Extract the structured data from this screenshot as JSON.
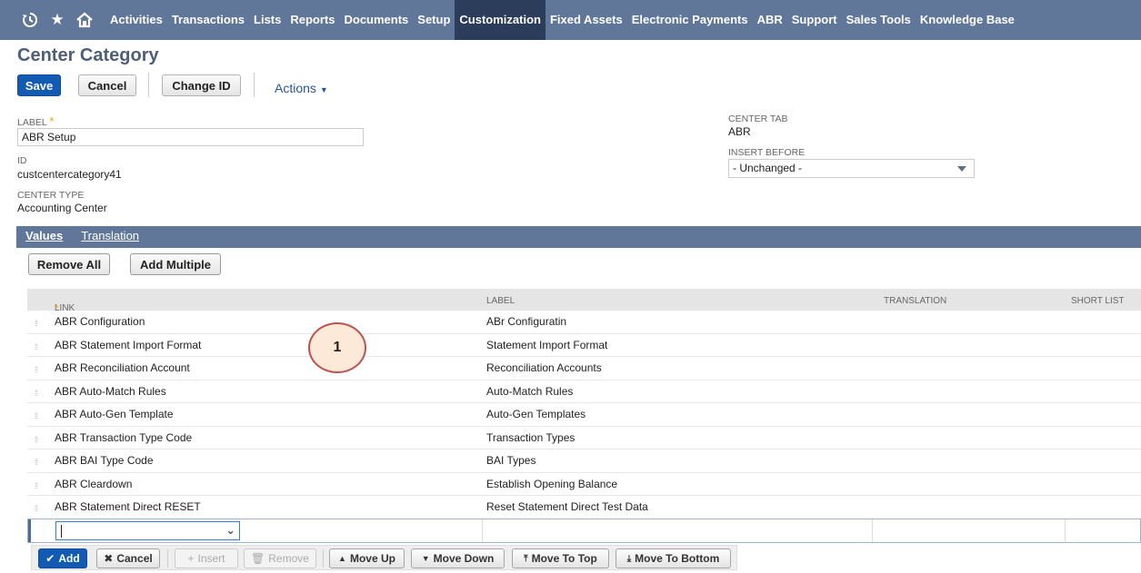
{
  "nav": {
    "icons": [
      "recent-icon",
      "star-icon",
      "home-icon"
    ],
    "items": [
      "Activities",
      "Transactions",
      "Lists",
      "Reports",
      "Documents",
      "Setup",
      "Customization",
      "Fixed Assets",
      "Electronic Payments",
      "ABR",
      "Support",
      "Sales Tools",
      "Knowledge Base"
    ],
    "active": "Customization"
  },
  "page": {
    "title": "Center Category"
  },
  "toolbar": {
    "save": "Save",
    "cancel": "Cancel",
    "change_id": "Change ID",
    "actions": "Actions"
  },
  "form": {
    "label": {
      "name": "LABEL",
      "value": "ABR Setup"
    },
    "id": {
      "name": "ID",
      "value": "custcentercategory41"
    },
    "center_type": {
      "name": "CENTER TYPE",
      "value": "Accounting Center"
    },
    "center_tab": {
      "name": "CENTER TAB",
      "value": "ABR"
    },
    "insert_before": {
      "name": "INSERT BEFORE",
      "value": "- Unchanged -"
    }
  },
  "tabs": {
    "values": "Values",
    "translation": "Translation"
  },
  "list_buttons": {
    "remove_all": "Remove All",
    "add_multiple": "Add Multiple"
  },
  "grid": {
    "headers": {
      "link": "LINK",
      "label": "LABEL",
      "translation": "TRANSLATION",
      "short_list": "SHORT LIST"
    },
    "rows": [
      {
        "link": "ABR Configuration",
        "label": "ABr Configuratin"
      },
      {
        "link": "ABR Statement Import Format",
        "label": "Statement Import Format"
      },
      {
        "link": "ABR Reconciliation Account",
        "label": "Reconciliation Accounts"
      },
      {
        "link": "ABR Auto-Match Rules",
        "label": "Auto-Match Rules"
      },
      {
        "link": "ABR Auto-Gen Template",
        "label": "Auto-Gen Templates"
      },
      {
        "link": "ABR Transaction Type Code",
        "label": "Transaction Types"
      },
      {
        "link": "ABR BAI Type Code",
        "label": "BAI Types"
      },
      {
        "link": "ABR Cleardown",
        "label": "Establish Opening Balance"
      },
      {
        "link": "ABR Statement Direct RESET",
        "label": "Reset Statement Direct Test Data"
      }
    ]
  },
  "row_actions": {
    "add": "Add",
    "cancel": "Cancel",
    "insert": "Insert",
    "remove": "Remove",
    "move_up": "Move Up",
    "move_down": "Move Down",
    "move_to_top": "Move To Top",
    "move_to_bottom": "Move To Bottom"
  },
  "callout": {
    "number": "1"
  },
  "colors": {
    "nav_bg": "#607799",
    "nav_active": "#2b3d5a",
    "primary": "#125ab2",
    "title": "#4d5f79",
    "required": "#f4a000",
    "callout_border": "#c0504d",
    "callout_fill": "#fde9d8"
  }
}
